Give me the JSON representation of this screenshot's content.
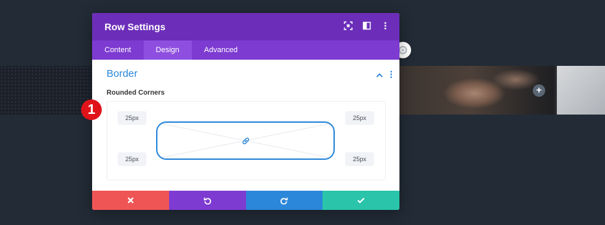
{
  "modal": {
    "title": "Row Settings",
    "tabs": [
      {
        "label": "Content",
        "active": false
      },
      {
        "label": "Design",
        "active": true
      },
      {
        "label": "Advanced",
        "active": false
      }
    ],
    "section": {
      "title": "Border",
      "field_label": "Rounded Corners",
      "corners": {
        "top_left": "25px",
        "top_right": "25px",
        "bottom_left": "25px",
        "bottom_right": "25px"
      }
    },
    "footer_icons": [
      "close-icon",
      "undo-icon",
      "redo-icon",
      "check-icon"
    ]
  },
  "annotation": {
    "number": "1"
  },
  "colors": {
    "header": "#6c2eb9",
    "tabs": "#7d3bd1",
    "accent": "#2b87da",
    "cancel": "#ef5555",
    "save": "#29c4a9",
    "badge": "#e0131b"
  }
}
